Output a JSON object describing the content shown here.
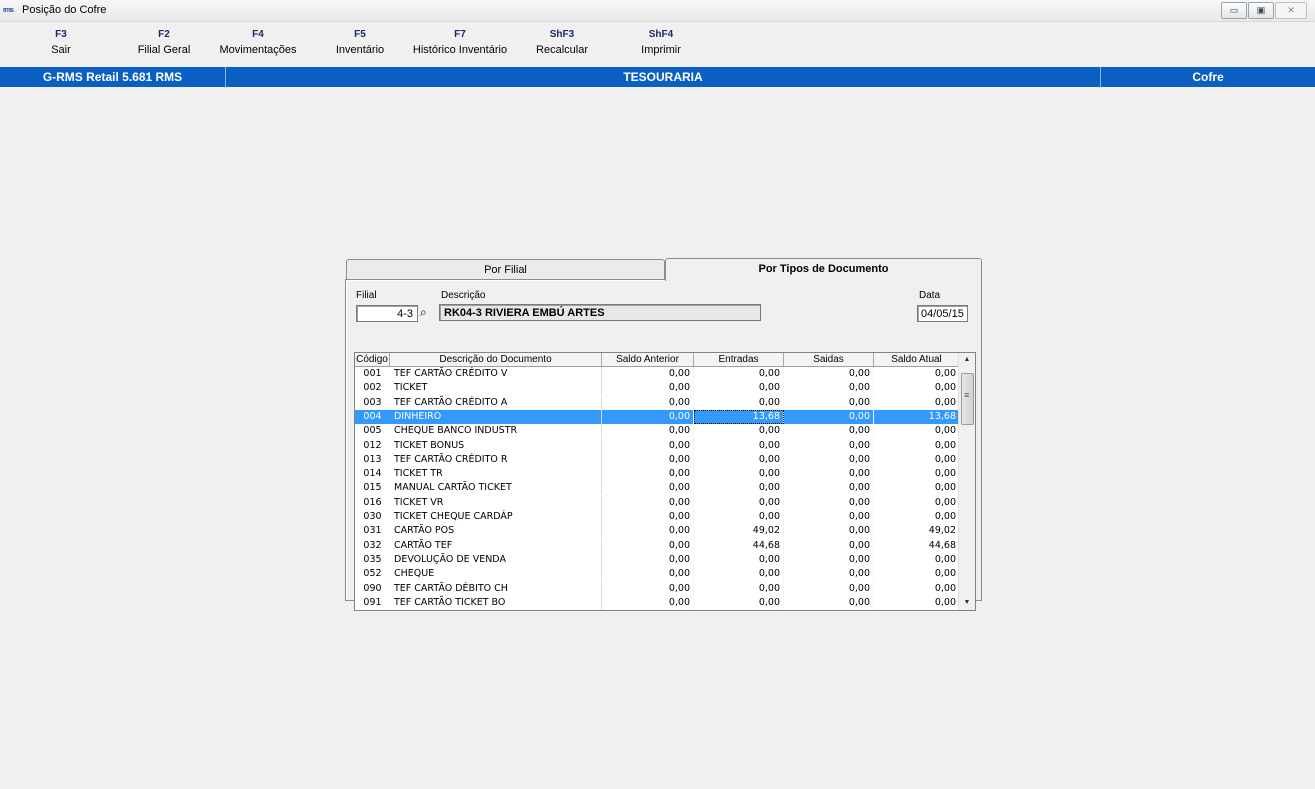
{
  "window": {
    "title": "Posição do Cofre",
    "icon_text": "rms"
  },
  "fkeys": [
    {
      "key": "F3",
      "label": "Sair"
    },
    {
      "key": "F2",
      "label": "Filial Geral"
    },
    {
      "key": "F4",
      "label": "Movimentações"
    },
    {
      "key": "F5",
      "label": "Inventário"
    },
    {
      "key": "F7",
      "label": "Histórico Inventário"
    },
    {
      "key": "ShF3",
      "label": "Recalcular"
    },
    {
      "key": "ShF4",
      "label": "Imprimir"
    }
  ],
  "statusbar": {
    "app": "G-RMS Retail 5.681 RMS",
    "module": "TESOURARIA",
    "screen": "Cofre"
  },
  "tabs": {
    "por_filial": "Por Filial",
    "por_tipos": "Por Tipos de Documento"
  },
  "form": {
    "filial_label": "Filial",
    "filial_value": "4-3",
    "descricao_label": "Descrição",
    "descricao_value": "RK04-3 RIVIERA EMBÚ ARTES",
    "data_label": "Data",
    "data_value": "04/05/15"
  },
  "table": {
    "columns": [
      "Código",
      "Descrição do Documento",
      "Saldo Anterior",
      "Entradas",
      "Saidas",
      "Saldo Atual"
    ],
    "selected_index": 3,
    "rows": [
      {
        "code": "001",
        "desc": "TEF CARTÃO CRÉDITO V",
        "saldo_anterior": "0,00",
        "entradas": "0,00",
        "saidas": "0,00",
        "saldo_atual": "0,00"
      },
      {
        "code": "002",
        "desc": "TICKET",
        "saldo_anterior": "0,00",
        "entradas": "0,00",
        "saidas": "0,00",
        "saldo_atual": "0,00"
      },
      {
        "code": "003",
        "desc": "TEF CARTÃO CRÉDITO A",
        "saldo_anterior": "0,00",
        "entradas": "0,00",
        "saidas": "0,00",
        "saldo_atual": "0,00"
      },
      {
        "code": "004",
        "desc": "DINHEIRO",
        "saldo_anterior": "0,00",
        "entradas": "13,68",
        "saidas": "0,00",
        "saldo_atual": "13,68"
      },
      {
        "code": "005",
        "desc": "CHEQUE BANCO INDUSTR",
        "saldo_anterior": "0,00",
        "entradas": "0,00",
        "saidas": "0,00",
        "saldo_atual": "0,00"
      },
      {
        "code": "012",
        "desc": "TICKET BONUS",
        "saldo_anterior": "0,00",
        "entradas": "0,00",
        "saidas": "0,00",
        "saldo_atual": "0,00"
      },
      {
        "code": "013",
        "desc": "TEF CARTÃO CRÉDITO R",
        "saldo_anterior": "0,00",
        "entradas": "0,00",
        "saidas": "0,00",
        "saldo_atual": "0,00"
      },
      {
        "code": "014",
        "desc": "TICKET TR",
        "saldo_anterior": "0,00",
        "entradas": "0,00",
        "saidas": "0,00",
        "saldo_atual": "0,00"
      },
      {
        "code": "015",
        "desc": "MANUAL CARTÃO TICKET",
        "saldo_anterior": "0,00",
        "entradas": "0,00",
        "saidas": "0,00",
        "saldo_atual": "0,00"
      },
      {
        "code": "016",
        "desc": "TICKET VR",
        "saldo_anterior": "0,00",
        "entradas": "0,00",
        "saidas": "0,00",
        "saldo_atual": "0,00"
      },
      {
        "code": "030",
        "desc": "TICKET CHEQUE CARDÁP",
        "saldo_anterior": "0,00",
        "entradas": "0,00",
        "saidas": "0,00",
        "saldo_atual": "0,00"
      },
      {
        "code": "031",
        "desc": "CARTÃO POS",
        "saldo_anterior": "0,00",
        "entradas": "49,02",
        "saidas": "0,00",
        "saldo_atual": "49,02"
      },
      {
        "code": "032",
        "desc": "CARTÃO TEF",
        "saldo_anterior": "0,00",
        "entradas": "44,68",
        "saidas": "0,00",
        "saldo_atual": "44,68"
      },
      {
        "code": "035",
        "desc": "DEVOLUÇÃO DE VENDA",
        "saldo_anterior": "0,00",
        "entradas": "0,00",
        "saidas": "0,00",
        "saldo_atual": "0,00"
      },
      {
        "code": "052",
        "desc": "CHEQUE",
        "saldo_anterior": "0,00",
        "entradas": "0,00",
        "saidas": "0,00",
        "saldo_atual": "0,00"
      },
      {
        "code": "090",
        "desc": "TEF CARTÃO DÉBITO CH",
        "saldo_anterior": "0,00",
        "entradas": "0,00",
        "saidas": "0,00",
        "saldo_atual": "0,00"
      },
      {
        "code": "091",
        "desc": "TEF CARTÃO TICKET BO",
        "saldo_anterior": "0,00",
        "entradas": "0,00",
        "saidas": "0,00",
        "saldo_atual": "0,00"
      }
    ]
  },
  "colors": {
    "status_bar": "#0a5fc2",
    "selection": "#3399ff"
  }
}
